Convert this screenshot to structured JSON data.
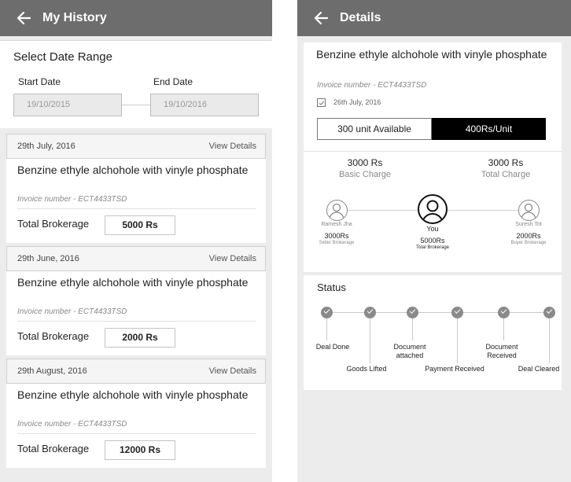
{
  "history": {
    "header_title": "My History",
    "date_range": {
      "title": "Select Date Range",
      "start_label": "Start Date",
      "end_label": "End Date",
      "start_value": "19/10/2015",
      "end_value": "19/10/2016"
    },
    "items": [
      {
        "date": "29th July, 2016",
        "view_details": "View Details",
        "product": "Benzine ethyle alchohole with vinyle phosphate",
        "invoice": "Invoice number - ECT4433TSD",
        "brokerage_label": "Total Brokerage",
        "brokerage_value": "5000 Rs"
      },
      {
        "date": "29th June, 2016",
        "view_details": "View Details",
        "product": "Benzine ethyle alchohole with vinyle phosphate",
        "invoice": "Invoice number - ECT4433TSD",
        "brokerage_label": "Total Brokerage",
        "brokerage_value": "2000 Rs"
      },
      {
        "date": "29th August, 2016",
        "view_details": "View Details",
        "product": "Benzine ethyle alchohole with vinyle phosphate",
        "invoice": "Invoice number - ECT4433TSD",
        "brokerage_label": "Total Brokerage",
        "brokerage_value": "12000 Rs"
      }
    ]
  },
  "details": {
    "header_title": "Details",
    "product": "Benzine ethyle alchohole with vinyle phosphate",
    "invoice": "Invoice number - ECT4433TSD",
    "date": "26th July, 2016",
    "available": "300 unit Available",
    "rate": "400Rs/Unit",
    "basic_charge": {
      "amount": "3000 Rs",
      "label": "Basic Charge"
    },
    "total_charge": {
      "amount": "3000 Rs",
      "label": "Total Charge"
    },
    "parties": {
      "seller": {
        "name": "Ramesh Jha",
        "amount": "3000Rs",
        "label": "Seller Brokerage"
      },
      "you": {
        "name": "You",
        "amount": "5000Rs",
        "label": "Total Brokerage"
      },
      "buyer": {
        "name": "Suresh Tot",
        "amount": "2000Rs",
        "label": "Buyer Brokerage"
      }
    },
    "status": {
      "title": "Status",
      "steps": [
        {
          "label": "Deal Done"
        },
        {
          "label": "Goods Lifted"
        },
        {
          "label": "Document attached"
        },
        {
          "label": "Payment Received"
        },
        {
          "label": "Document Received"
        },
        {
          "label": "Deal Cleared"
        }
      ]
    }
  },
  "colors": {
    "appbar": "#6d6d6d",
    "background": "#ececec",
    "rate_box": "#000000",
    "status_dot": "#8a8a8a"
  },
  "icons": [
    "back-arrow-icon",
    "calendar-icon",
    "user-icon",
    "check-icon"
  ]
}
